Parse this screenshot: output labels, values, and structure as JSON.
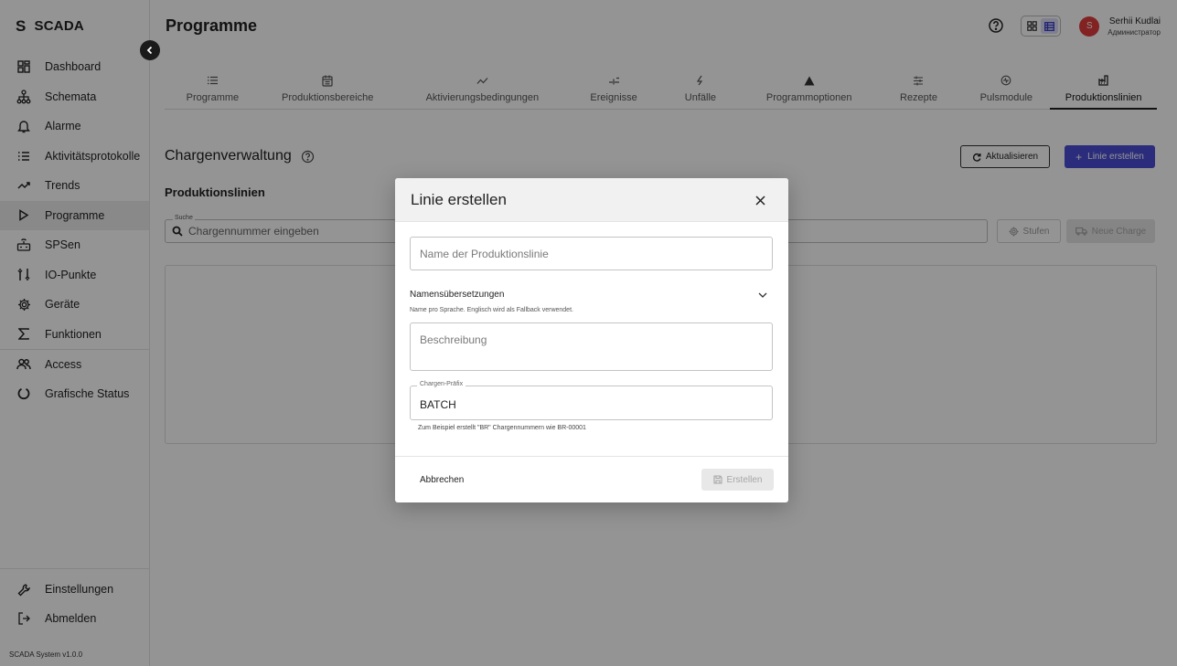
{
  "app": {
    "logo_letter": "S",
    "logo_text": "SCADA",
    "version": "SCADA System v1.0.0"
  },
  "sidebar": {
    "items": [
      {
        "label": "Dashboard",
        "icon": "dashboard-icon"
      },
      {
        "label": "Schemata",
        "icon": "hierarchy-icon"
      },
      {
        "label": "Alarme",
        "icon": "bell-icon"
      },
      {
        "label": "Aktivitätsprotokolle",
        "icon": "list-icon"
      },
      {
        "label": "Trends",
        "icon": "trend-icon"
      },
      {
        "label": "Programme",
        "icon": "play-icon",
        "active": true
      },
      {
        "label": "SPSen",
        "icon": "plc-icon"
      },
      {
        "label": "IO-Punkte",
        "icon": "io-points-icon"
      },
      {
        "label": "Geräte",
        "icon": "gear-icon"
      },
      {
        "label": "Funktionen",
        "icon": "sigma-icon"
      },
      {
        "label": "Access",
        "icon": "users-icon"
      },
      {
        "label": "Grafische Status",
        "icon": "circle-status-icon"
      }
    ],
    "bottom": [
      {
        "label": "Einstellungen",
        "icon": "wrench-icon"
      },
      {
        "label": "Abmelden",
        "icon": "logout-icon"
      }
    ]
  },
  "topbar": {
    "title": "Programme",
    "user_name": "Serhii Kudlai",
    "user_role": "Администратор",
    "avatar_letter": "S"
  },
  "tabs": [
    {
      "label": "Programme",
      "icon": "list-icon"
    },
    {
      "label": "Produktionsbereiche",
      "icon": "calendar-icon"
    },
    {
      "label": "Aktivierungsbedingungen",
      "icon": "trend-icon"
    },
    {
      "label": "Ereignisse",
      "icon": "event-icon"
    },
    {
      "label": "Unfälle",
      "icon": "bolt-icon"
    },
    {
      "label": "Programmoptionen",
      "icon": "warning-icon"
    },
    {
      "label": "Rezepte",
      "icon": "sliders-icon"
    },
    {
      "label": "Pulsmodule",
      "icon": "pulse-icon"
    },
    {
      "label": "Produktionslinien",
      "icon": "factory-icon",
      "active": true
    }
  ],
  "main": {
    "section_title": "Chargenverwaltung",
    "refresh_label": "Aktualisieren",
    "create_line_label": "Linie erstellen",
    "sub_title": "Produktionslinien",
    "search_legend": "Suche",
    "search_placeholder": "Chargennummer eingeben",
    "stufen_label": "Stufen",
    "new_charge_label": "Neue Charge"
  },
  "modal": {
    "title": "Linie erstellen",
    "name_placeholder": "Name der Produktionslinie",
    "translations_title": "Namensübersetzungen",
    "translations_hint": "Name pro Sprache. Englisch wird als Fallback verwendet.",
    "description_placeholder": "Beschreibung",
    "prefix_legend": "Chargen-Präfix",
    "prefix_value": "BATCH",
    "prefix_hint": "Zum Beispiel erstellt \"BR\" Chargennummern wie BR-00001",
    "cancel_label": "Abbrechen",
    "submit_label": "Erstellen"
  },
  "colors": {
    "accent": "#4b4fd6",
    "avatar": "#e23b3b",
    "overlay": "rgba(0,0,0,0.42)"
  }
}
